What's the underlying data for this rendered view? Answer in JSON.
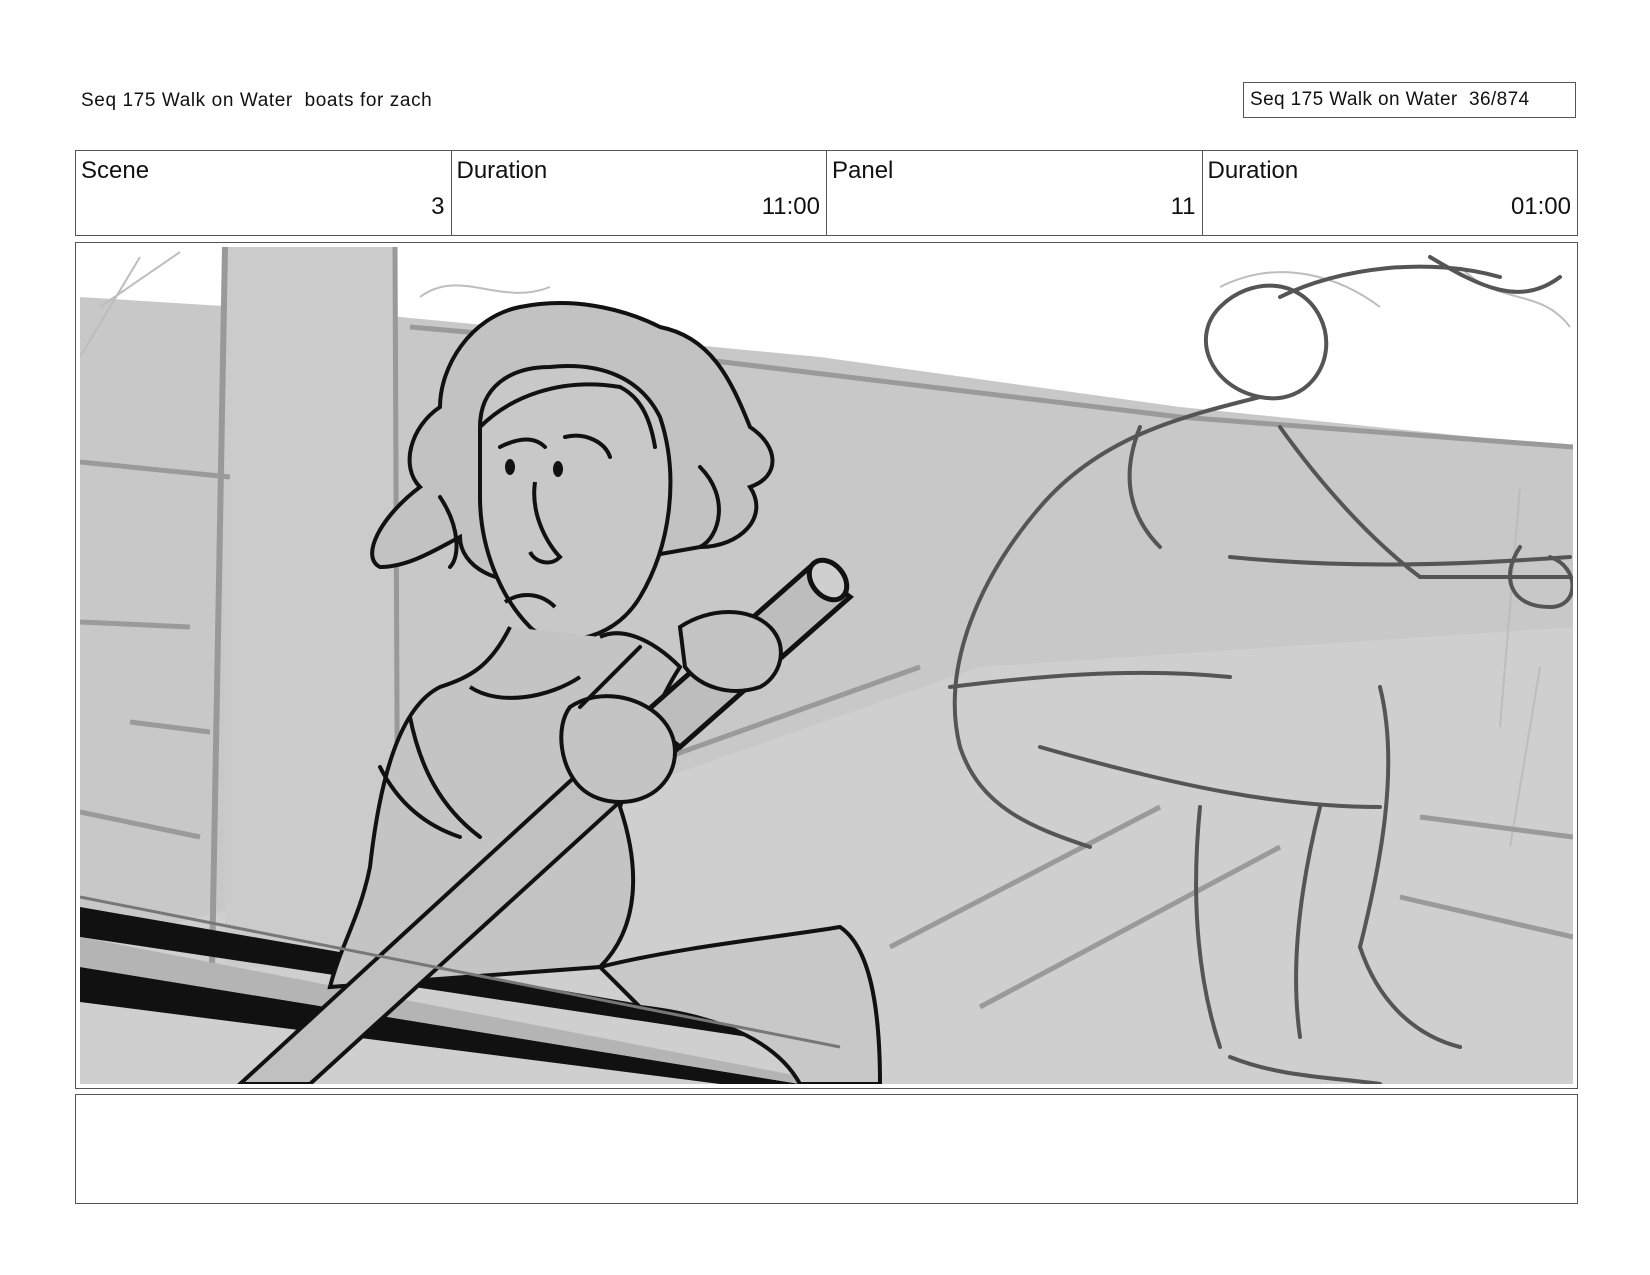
{
  "header": {
    "title": "Seq 175 Walk on Water  boats for zach",
    "page_counter": "Seq 175 Walk on Water  36/874"
  },
  "info": {
    "scene_label": "Scene",
    "scene_value": "3",
    "duration_label": "Duration",
    "duration_value": "11:00",
    "panel_label": "Panel",
    "panel_value": "11",
    "panel_duration_label": "Duration",
    "panel_duration_value": "01:00"
  },
  "notes": {
    "text": ""
  }
}
